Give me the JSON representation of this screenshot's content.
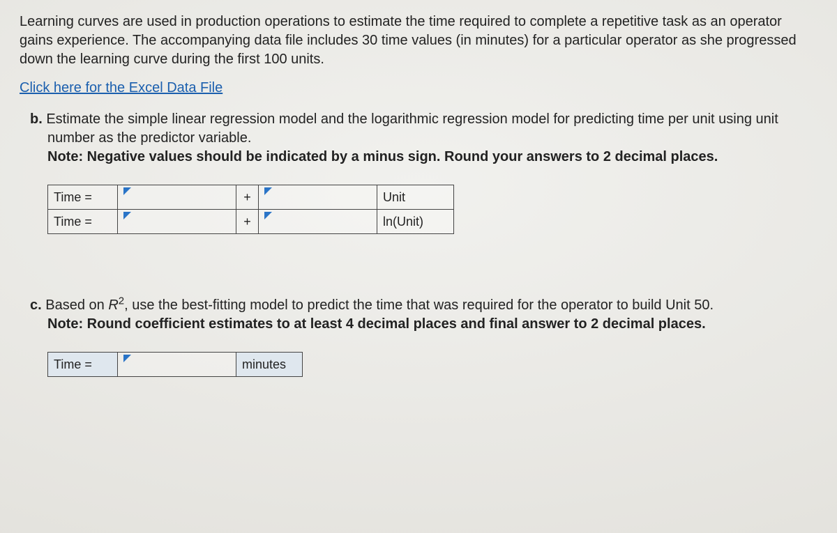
{
  "intro": "Learning curves are used in production operations to estimate the time required to complete a repetitive task as an operator gains experience. The accompanying data file includes 30 time values (in minutes) for a particular operator as she progressed down the learning curve during the first 100 units.",
  "link": "Click here for the Excel Data File",
  "partB": {
    "label": "b.",
    "text": "Estimate the simple linear regression model and the logarithmic regression model for predicting time per unit using unit number as the predictor variable.",
    "note": "Note: Negative values should be indicated by a minus sign. Round your answers to 2 decimal places.",
    "rows": [
      {
        "lhs": "Time =",
        "plus": "+",
        "predictor": "Unit"
      },
      {
        "lhs": "Time =",
        "plus": "+",
        "predictor": "ln(Unit)"
      }
    ]
  },
  "partC": {
    "label": "c.",
    "text_before": "Based on ",
    "r2": "R",
    "r2_sup": "2",
    "text_after": ", use the best-fitting model to predict the time that was required for the operator to build Unit 50.",
    "note": "Note: Round coefficient estimates to at least 4 decimal places and final answer to 2 decimal places.",
    "row": {
      "lhs": "Time =",
      "unit": "minutes"
    }
  }
}
